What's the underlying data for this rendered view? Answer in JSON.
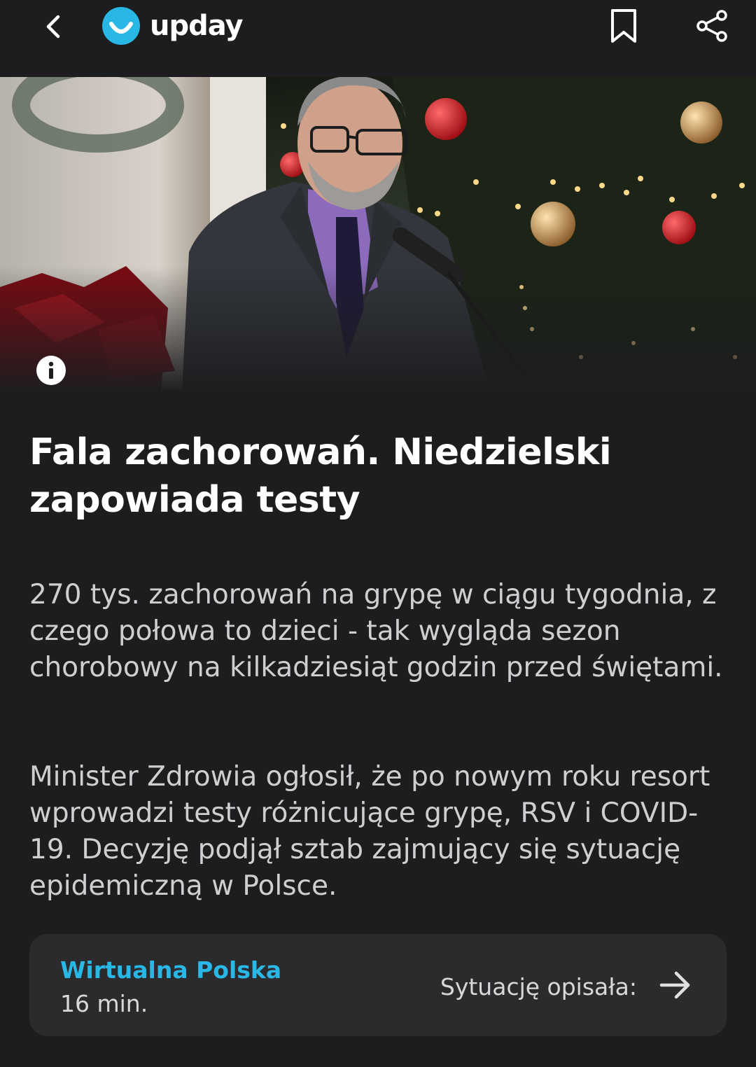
{
  "app": {
    "name": "upday",
    "accent_color": "#29b8e6"
  },
  "toolbar": {
    "back_icon": "chevron-left-icon",
    "bookmark_icon": "bookmark-icon",
    "share_icon": "share-icon"
  },
  "hero": {
    "info_icon": "info-icon"
  },
  "article": {
    "headline": "Fala zachorowań. Niedzielski zapowiada testy",
    "paragraphs": [
      "270 tys. zachorowań na grypę w ciągu tygodnia, z czego połowa to dzieci - tak wygląda sezon chorobowy na kilkadziesiąt godzin przed świętami.",
      "Minister Zdrowia ogłosił, że po nowym roku resort wprowadzi testy różnicujące grypę, RSV i COVID-19. Decyzję podjął sztab zajmujący się sytuację epidemiczną w Polsce."
    ]
  },
  "source": {
    "name": "Wirtualna Polska",
    "time": "16 min.",
    "description": "Sytuację opisała:",
    "arrow_icon": "arrow-right-icon"
  }
}
